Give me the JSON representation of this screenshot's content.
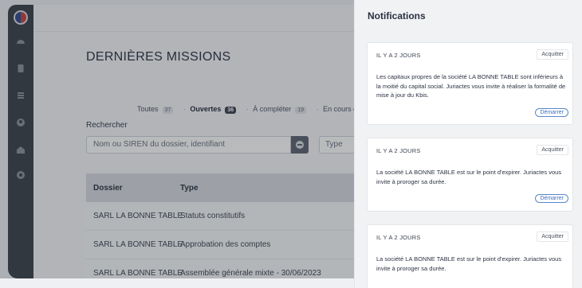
{
  "sidebar": {
    "icons": [
      "dashboard-icon",
      "document-icon",
      "list-icon",
      "user-icon",
      "building-icon",
      "settings-icon"
    ]
  },
  "main": {
    "title": "DERNIÈRES MISSIONS",
    "filters": [
      {
        "label": "Toutes",
        "count": "37"
      },
      {
        "label": "Ouvertes",
        "count": "36"
      },
      {
        "label": "À compléter",
        "count": "19"
      },
      {
        "label": "En cours de traite",
        "count": ""
      }
    ],
    "search": {
      "label": "Rechercher",
      "placeholder": "Nom ou SIREN du dossier, identifiant",
      "type_placeholder": "Type"
    },
    "table": {
      "headers": [
        "Dossier",
        "Type"
      ],
      "rows": [
        [
          "SARL LA BONNE TABLE",
          "Statuts constitutifs"
        ],
        [
          "SARL LA BONNE TABLE",
          "Approbation des comptes"
        ],
        [
          "SARL LA BONNE TABLE",
          "Assemblée générale mixte - 30/06/2023"
        ]
      ]
    }
  },
  "notifications": {
    "title": "Notifications",
    "ack_label": "Acquitter",
    "start_label": "Démarrer",
    "items": [
      {
        "when": "IL Y A 2 JOURS",
        "text": "Les capitaux propres de la société LA BONNE TABLE sont inférieurs à la moitié du capital social. Juriactes vous invite à réaliser la formalité de mise à jour du Kbis."
      },
      {
        "when": "IL Y A 2 JOURS",
        "text": "La société LA BONNE TABLE est sur le point d'expirer. Juriactes vous invite à proroger sa durée."
      },
      {
        "when": "IL Y A 2 JOURS",
        "text": "La société LA BONNE TABLE est sur le point d'expirer. Juriactes vous invite à proroger sa durée."
      }
    ]
  }
}
